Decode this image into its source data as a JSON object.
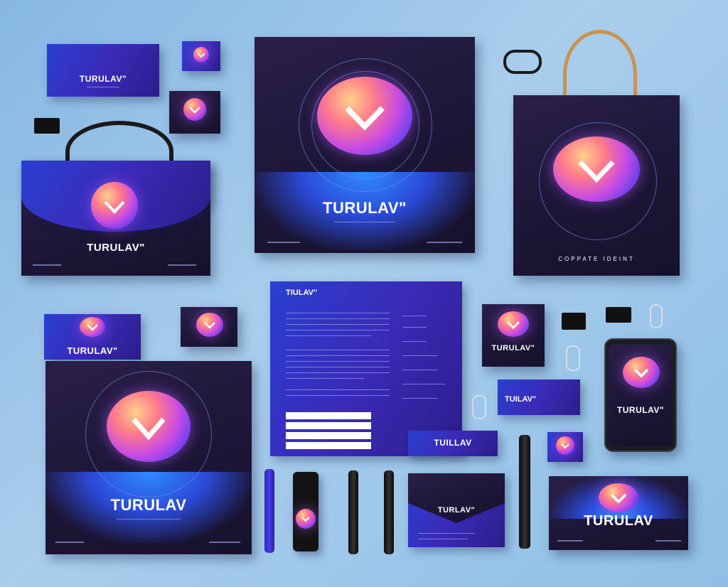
{
  "brand_marks": {
    "card_top_left": "TURULAV\"",
    "poster_top": "TURULAV\"",
    "bag_left": "TURULAV\"",
    "box_mid_left": "TURULAV\"",
    "poster_bottom": "TURULAV",
    "letterhead": "TIULAV\"",
    "card_right": "TURULAV\"",
    "card_right_small": "TUILAV\"",
    "strip_card": "TUILLAV",
    "phone": "TURULAV\"",
    "envelope": "TURLAV\"",
    "box_bottom_right": "TURULAV"
  },
  "bag_right_tagline": "COPPATE IDEINT"
}
